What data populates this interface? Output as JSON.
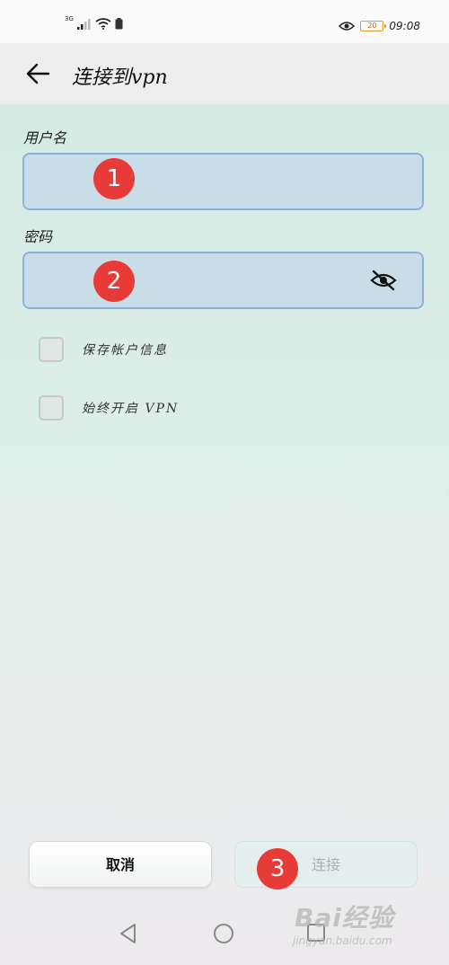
{
  "status_bar": {
    "network": "3G",
    "battery": "20",
    "time": "09:08"
  },
  "app_bar": {
    "title": "连接到vpn"
  },
  "form": {
    "username_label": "用户名",
    "username_value": "",
    "password_label": "密码",
    "password_value": "",
    "save_account_label": "保存帐户信息",
    "always_on_label": "始终开启 VPN",
    "save_account_checked": false,
    "always_on_checked": false
  },
  "annotations": {
    "badge_1": "1",
    "badge_2": "2",
    "badge_3": "3"
  },
  "buttons": {
    "cancel": "取消",
    "connect": "连接"
  },
  "watermark": {
    "brand": "Bai经验",
    "url": "jingyan.baidu.com"
  },
  "colors": {
    "badge": "#e83a37",
    "field_border": "#8fb0de",
    "field_bg": "#c9dde8"
  }
}
